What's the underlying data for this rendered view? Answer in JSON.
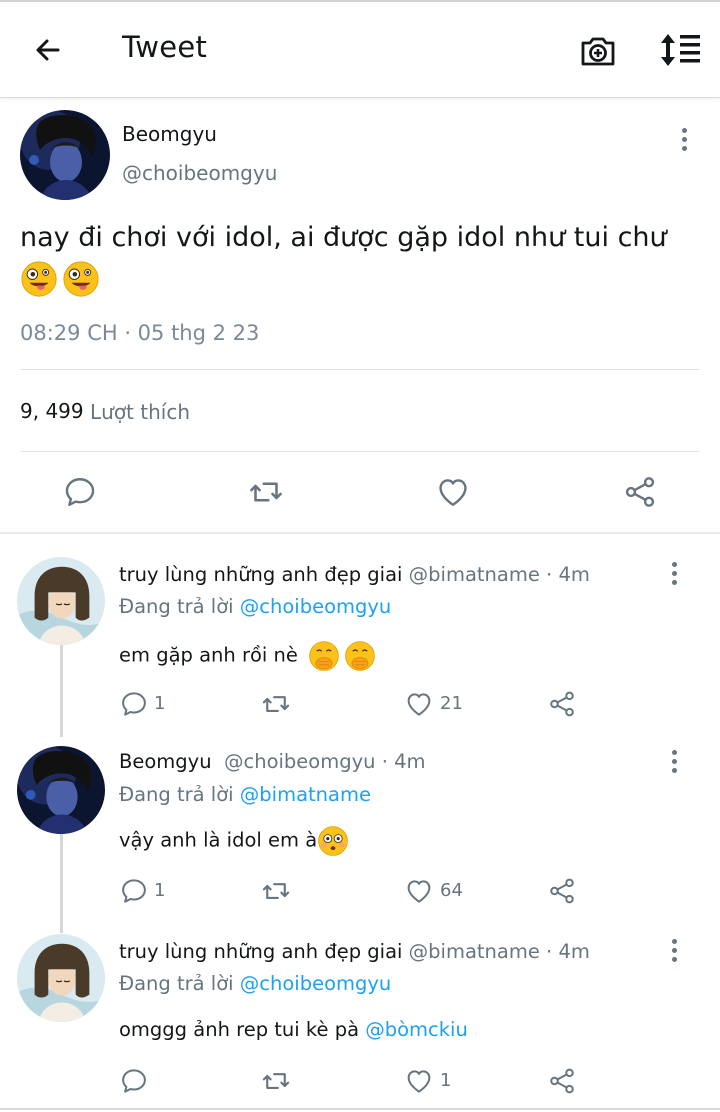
{
  "header": {
    "title": "Tweet"
  },
  "main_tweet": {
    "display_name": "Beomgyu",
    "handle": "@choibeomgyu",
    "text": "nay đi chơi với idol,  ai được gặp idol như tui chư",
    "emojis": [
      "zany-face",
      "zany-face"
    ],
    "timestamp": "08:29 CH · 05 thg 2 23",
    "likes_count": "9, 499",
    "likes_label": "Lượt thích"
  },
  "replies": [
    {
      "display_name": "truy lùng những anh đẹp giai",
      "handle_time": "@bimatname · 4m",
      "replying_prefix": "Đang trả lời",
      "replying_to": "@choibeomgyu",
      "text": "em gặp anh rồi nè",
      "emojis": [
        "hand-over-mouth",
        "hand-over-mouth"
      ],
      "reply_count": "1",
      "retweet_count": "",
      "like_count": "21"
    },
    {
      "display_name": "Beomgyu",
      "handle_time": "@choibeomgyu · 4m",
      "replying_prefix": "Đang trả lời",
      "replying_to": "@bimatname",
      "text": "vậy anh là idol em à",
      "emojis": [
        "flushed-face"
      ],
      "reply_count": "1",
      "retweet_count": "",
      "like_count": "64"
    },
    {
      "display_name": "truy lùng những anh đẹp giai",
      "handle_time": "@bimatname · 4m",
      "replying_prefix": "Đang trả lời",
      "replying_to": "@choibeomgyu",
      "text": "omggg ảnh rep tui kè pà",
      "mention": "@bòmckiu",
      "reply_count": "",
      "retweet_count": "",
      "like_count": "1"
    }
  ],
  "icons": {
    "back": "arrow-left-icon",
    "camera": "camera-plus-icon",
    "sort": "sort-list-icon",
    "more": "more-vertical-icon",
    "reply": "reply-bubble-icon",
    "retweet": "retweet-icon",
    "like": "heart-icon",
    "share": "share-icon"
  },
  "colors": {
    "text": "#14171a",
    "secondary": "#66757f",
    "link": "#1da1f2",
    "divider": "#e1e5e8"
  }
}
